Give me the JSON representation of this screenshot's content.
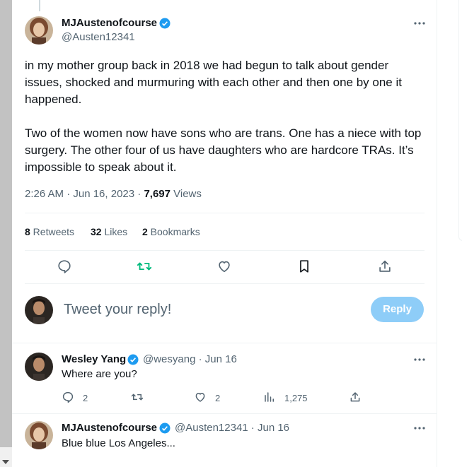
{
  "main_tweet": {
    "author_name": "MJAustenofcourse",
    "author_handle": "@Austen12341",
    "body": "in my mother group back in 2018 we had begun to talk about gender issues, shocked and murmuring with each other and then one by one it happened.\n\nTwo of the women now have sons who are trans. One has a niece with top surgery. The other four of us have daughters who are hardcore TRAs. It’s impossible to speak about it.",
    "timestamp": "2:26 AM · Jun 16, 2023 · ",
    "views_count": "7,697",
    "views_label": " Views",
    "retweets_count": "8",
    "retweets_label": " Retweets",
    "likes_count": "32",
    "likes_label": " Likes",
    "bookmarks_count": "2",
    "bookmarks_label": " Bookmarks"
  },
  "reply_box": {
    "placeholder": "Tweet your reply!",
    "button_label": "Reply"
  },
  "replies": [
    {
      "author_name": "Wesley Yang",
      "author_handle": "@wesyang",
      "time": " · Jun 16",
      "body": "Where are you?",
      "reply_count": "2",
      "retweet_count": "",
      "like_count": "2",
      "views_count": "1,275"
    },
    {
      "author_name": "MJAustenofcourse",
      "author_handle": "@Austen12341",
      "time": " · Jun 16",
      "body": "Blue blue Los Angeles..."
    }
  ],
  "icons": {
    "verified": "verified-badge-icon",
    "more": "more-dots-icon",
    "reply": "reply-icon",
    "retweet": "retweet-icon",
    "like": "heart-icon",
    "bookmark": "bookmark-icon",
    "share": "share-icon",
    "views": "views-chart-icon"
  },
  "colors": {
    "accent": "#1d9bf0",
    "retweet_active": "#00ba7c",
    "reply_button_disabled": "#8ecdf8",
    "secondary_text": "#536471"
  }
}
